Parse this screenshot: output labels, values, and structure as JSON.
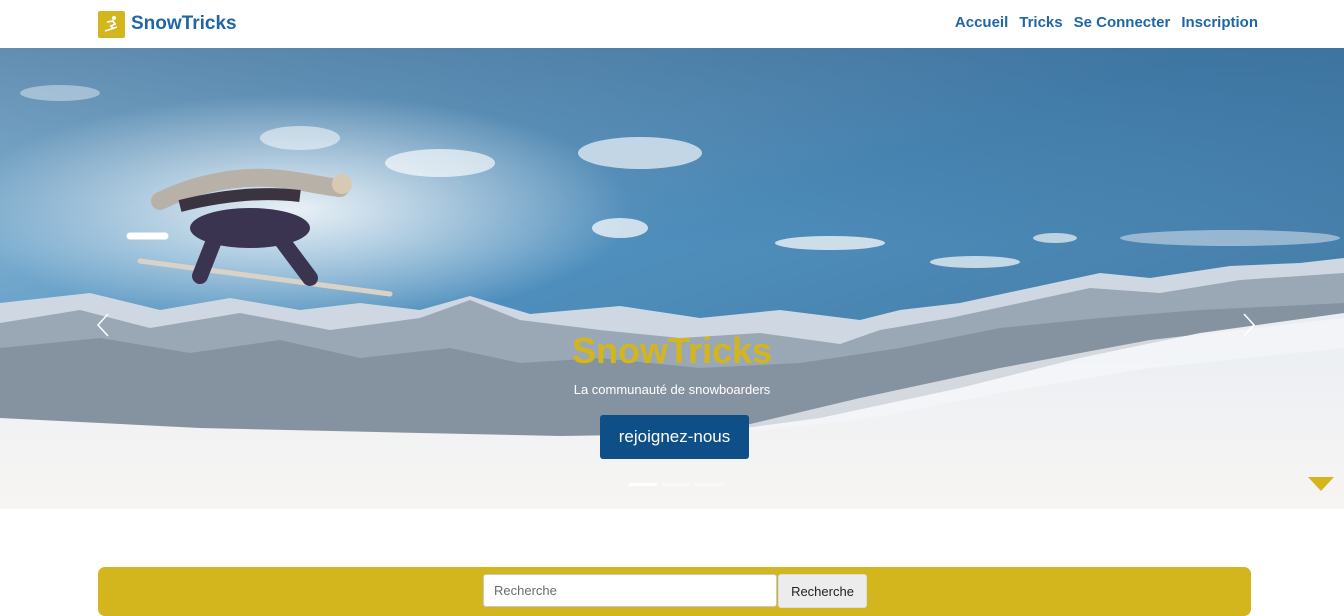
{
  "brand": {
    "name": "SnowTricks",
    "logo_icon": "snowboarder-icon",
    "logo_color": "#d3b51e"
  },
  "nav": {
    "links": [
      {
        "label": "Accueil"
      },
      {
        "label": "Tricks"
      },
      {
        "label": "Se Connecter"
      },
      {
        "label": "Inscription"
      }
    ]
  },
  "hero": {
    "title": "SnowTricks",
    "subtitle": "La communauté de snowboarders",
    "cta_label": "rejoignez-nous",
    "prev_icon": "chevron-left-icon",
    "next_icon": "chevron-right-icon",
    "scroll_icon": "triangle-down-icon",
    "slide_count": 3,
    "active_slide": 1
  },
  "search": {
    "placeholder": "Recherche",
    "value": "",
    "button_label": "Recherche"
  },
  "colors": {
    "accent": "#d3b51e",
    "link": "#1f66a6",
    "cta": "#0d4f86"
  }
}
